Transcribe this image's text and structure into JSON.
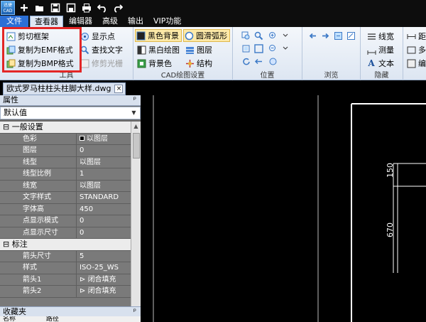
{
  "app": {
    "logo_text": "迅捷CAD",
    "quick_access": [
      "new-icon",
      "open-icon",
      "save-icon",
      "save-as-icon",
      "print-icon",
      "undo-icon",
      "redo-icon"
    ]
  },
  "menu_tabs": [
    {
      "label": "文件"
    },
    {
      "label": "查看器"
    },
    {
      "label": "编辑器"
    },
    {
      "label": "高级"
    },
    {
      "label": "输出"
    },
    {
      "label": "VIP功能"
    }
  ],
  "ribbon": {
    "tools_group": {
      "label": "工具",
      "items": [
        "剪切框架",
        "复制为EMF格式",
        "复制为BMP格式"
      ],
      "col2": [
        "显示点",
        "查找文字",
        "修剪光栅"
      ]
    },
    "cad_settings_group": {
      "label": "CAD绘图设置",
      "items": [
        "黑色背景",
        "黑白绘图",
        "背景色"
      ],
      "col2": [
        "圆滑弧形",
        "图层",
        "结构"
      ]
    },
    "position_group": {
      "label": "位置"
    },
    "browse_group": {
      "label": "浏览"
    },
    "hide_group": {
      "label": "隐藏",
      "items": [
        "线宽",
        "测量",
        "文本"
      ]
    },
    "right_group": {
      "items": [
        "距",
        "多",
        "编"
      ]
    }
  },
  "document": {
    "tab_label": "欧式罗马柱柱头柱脚大样.dwg",
    "close_glyph": "×"
  },
  "properties": {
    "title": "属性",
    "pin": "ᵖ",
    "selector_value": "默认值",
    "categories": [
      {
        "name": "一般设置",
        "rows": [
          {
            "k": "色彩",
            "v": "以图层",
            "swatch": true
          },
          {
            "k": "图层",
            "v": "0"
          },
          {
            "k": "线型",
            "v": "以图层"
          },
          {
            "k": "线型比例",
            "v": "1"
          },
          {
            "k": "线宽",
            "v": "以图层"
          },
          {
            "k": "文字样式",
            "v": "STANDARD"
          },
          {
            "k": "字体高",
            "v": "450"
          },
          {
            "k": "点显示模式",
            "v": "0"
          },
          {
            "k": "点显示尺寸",
            "v": "0"
          }
        ]
      },
      {
        "name": "标注",
        "rows": [
          {
            "k": "箭头尺寸",
            "v": "5"
          },
          {
            "k": "样式",
            "v": "ISO-25_WS"
          },
          {
            "k": "箭头1",
            "v": "闭合填充",
            "arrow": true
          },
          {
            "k": "箭头2",
            "v": "闭合填充",
            "arrow": true
          }
        ]
      }
    ]
  },
  "favorites": {
    "title": "收藏夹",
    "columns": [
      "名称",
      "路径"
    ]
  },
  "drawing": {
    "dim_top": "150",
    "dim_side": "670"
  },
  "colors": {
    "file_tab": "#2b6fd6",
    "highlight": "#e32626",
    "canvas": "#000000"
  }
}
